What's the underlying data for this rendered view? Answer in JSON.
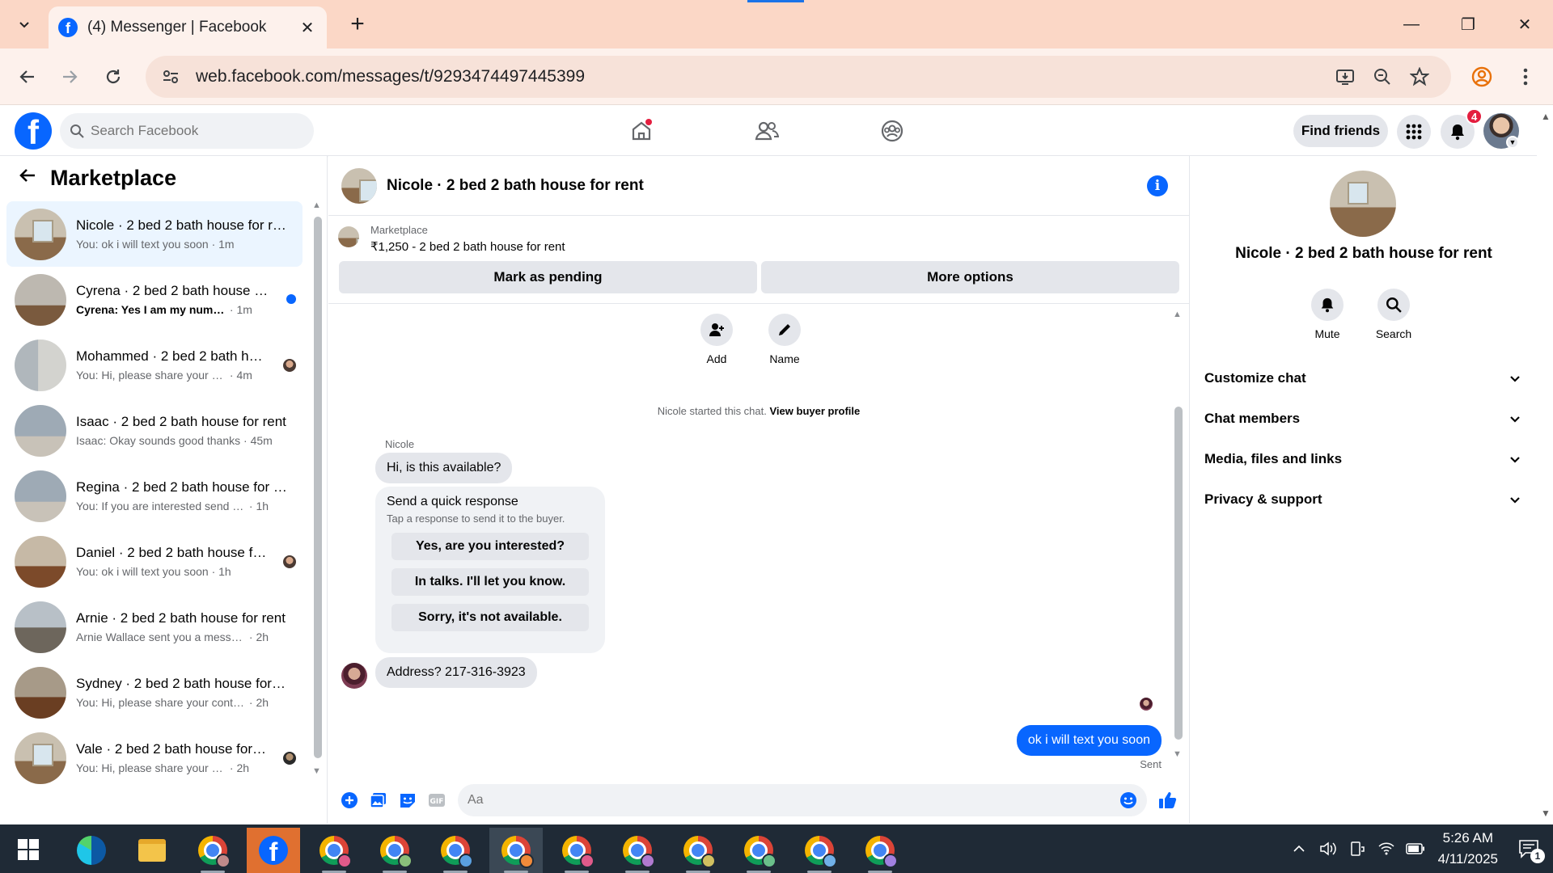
{
  "browser": {
    "tab_title": "(4) Messenger | Facebook",
    "tab_close": "✕",
    "new_tab": "+",
    "url": "web.facebook.com/messages/t/9293474497445399",
    "window_controls": {
      "minimize": "—",
      "restore": "❐",
      "close": "✕"
    }
  },
  "facebook": {
    "search_placeholder": "Search Facebook",
    "find_friends": "Find friends",
    "notification_count": "4",
    "logo": "f",
    "accent_color": "#0866ff"
  },
  "left_pane": {
    "title": "Marketplace",
    "conversations": [
      {
        "name": "Nicole · 2 bed 2 bath house for rent",
        "preview": "You: ok i will text you soon",
        "time": "· 1m",
        "active": true
      },
      {
        "name": "Cyrena · 2 bed 2 bath house for rent",
        "preview": "Cyrena: Yes I am my number is...",
        "time": "· 1m",
        "unread": true
      },
      {
        "name": "Mohammed · 2 bed 2 bath house for rent",
        "preview": "You: Hi, please share your cont...",
        "time": "· 4m"
      },
      {
        "name": "Isaac · 2 bed 2 bath house for rent",
        "preview": "Isaac: Okay sounds good thanks",
        "time": "· 45m"
      },
      {
        "name": "Regina · 2 bed 2 bath house for rent",
        "preview": "You: If you are interested send me ...",
        "time": "· 1h"
      },
      {
        "name": "Daniel · 2 bed 2 bath house for rent",
        "preview": "You: ok i will text you soon",
        "time": "· 1h"
      },
      {
        "name": "Arnie · 2 bed 2 bath house for rent",
        "preview": "Arnie Wallace sent you a message ...",
        "time": "· 2h"
      },
      {
        "name": "Sydney · 2 bed 2 bath house for rent",
        "preview": "You: Hi, please share your contact ...",
        "time": "· 2h"
      },
      {
        "name": "Vale · 2 bed 2 bath house for rent",
        "preview": "You: Hi, please share your conta...",
        "time": "· 2h"
      }
    ]
  },
  "chat": {
    "title": "Nicole · 2 bed 2 bath house for rent",
    "listing_category": "Marketplace",
    "listing_desc": "₹1,250 - 2 bed 2 bath house for rent",
    "mark_pending": "Mark as pending",
    "more_options": "More options",
    "add_label": "Add",
    "name_label": "Name",
    "started_text": "Nicole started this chat.",
    "view_buyer_profile": "View buyer profile",
    "sender_name": "Nicole",
    "message_1": "Hi, is this available?",
    "quick_response_title": "Send a quick response",
    "quick_response_sub": "Tap a response to send it to the buyer.",
    "quick_responses": [
      "Yes, are you interested?",
      "In talks. I'll let you know.",
      "Sorry, it's not available."
    ],
    "message_2": "Address? 217-316-3923",
    "outgoing_message": "ok i will text you soon",
    "sent_label": "Sent",
    "composer_placeholder": "Aa"
  },
  "right_pane": {
    "name": "Nicole · 2 bed 2 bath house for rent",
    "mute_label": "Mute",
    "search_label": "Search",
    "sections": [
      "Customize chat",
      "Chat members",
      "Media, files and links",
      "Privacy & support"
    ]
  },
  "taskbar": {
    "time": "5:26 AM",
    "date": "4/11/2025",
    "notification_count": "1"
  }
}
